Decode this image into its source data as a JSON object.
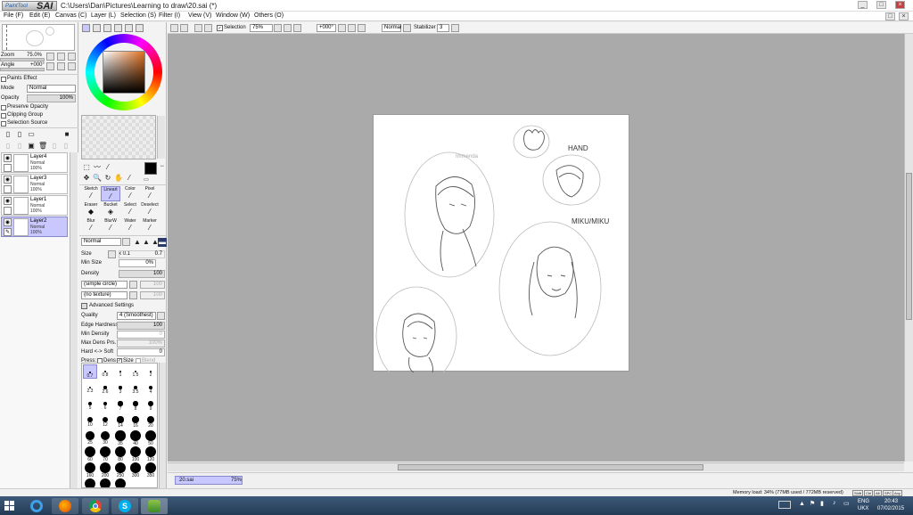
{
  "app": {
    "logo_sub": "PaintTool",
    "logo_main": "SAI",
    "title": "C:\\Users\\Dan\\Pictures\\Learning to draw\\20.sai (*)",
    "win_min": "_",
    "win_max": "□",
    "win_close": "×",
    "doc_min": "_",
    "doc_max": "□",
    "doc_close": "×"
  },
  "menu": [
    "File (F)",
    "Edit (E)",
    "Canvas (C)",
    "Layer (L)",
    "Selection (S)",
    "Filter (I)",
    "View (V)",
    "Window (W)",
    "Others (O)"
  ],
  "navigator": {
    "zoom_label": "Zoom",
    "zoom_value": "75.0%",
    "angle_label": "Angle",
    "angle_value": "+000°"
  },
  "layer_props": {
    "paints_effect": "Paints Effect",
    "mode_label": "Mode",
    "mode_value": "Normal",
    "opacity_label": "Opacity",
    "opacity_value": "100%",
    "preserve_opacity": "Preserve Opacity",
    "clipping_group": "Clipping Group",
    "selection_source": "Selection Source"
  },
  "layers": [
    {
      "name": "Layer4",
      "mode": "Normal",
      "opacity": "100%",
      "selected": false
    },
    {
      "name": "Layer3",
      "mode": "Normal",
      "opacity": "100%",
      "selected": false
    },
    {
      "name": "Layer1",
      "mode": "Normal",
      "opacity": "100%",
      "selected": false
    },
    {
      "name": "Layer2",
      "mode": "Normal",
      "opacity": "100%",
      "selected": true
    }
  ],
  "brush_tools": [
    {
      "label": "Sketch",
      "selected": false
    },
    {
      "label": "Lineart",
      "selected": true
    },
    {
      "label": "Color",
      "selected": false
    },
    {
      "label": "Pixel",
      "selected": false
    },
    {
      "label": "Eraser",
      "selected": false
    },
    {
      "label": "Bucket",
      "selected": false
    },
    {
      "label": "Select",
      "selected": false
    },
    {
      "label": "Deselect",
      "selected": false
    },
    {
      "label": "Blur",
      "selected": false
    },
    {
      "label": "BlurW",
      "selected": false
    },
    {
      "label": "Water",
      "selected": false
    },
    {
      "label": "Marker",
      "selected": false
    }
  ],
  "brush_settings": {
    "blend_mode": "Normal",
    "size_label": "Size",
    "size_mult": "x 0.1",
    "size_value": "0.7",
    "min_size_label": "Min Size",
    "min_size_value": "0%",
    "density_label": "Density",
    "density_value": "100",
    "shape": "(simple circle)",
    "shape_value": "100",
    "texture": "(no texture)",
    "texture_value": "100",
    "advanced": "Advanced Settings",
    "quality_label": "Quality",
    "quality_value": "4 (Smoothest)",
    "edge_hardness_label": "Edge Hardness",
    "edge_hardness_value": "100",
    "min_density_label": "Min Density",
    "min_density_value": "0",
    "max_dens_prs_label": "Max Dens Prs.",
    "max_dens_prs_value": "100%",
    "hard_soft_label": "Hard <-> Soft",
    "hard_soft_value": "0",
    "press_label": "Press:",
    "press_dens": "Dens",
    "press_size": "Size",
    "press_blend": "Blend"
  },
  "brush_sizes": [
    "0.7",
    "0.8",
    "1",
    "1.5",
    "2",
    "2.3",
    "2.6",
    "3",
    "3.5",
    "4",
    "5",
    "6",
    "7",
    "8",
    "9",
    "10",
    "12",
    "14",
    "16",
    "20",
    "25",
    "30",
    "35",
    "40",
    "50",
    "60",
    "70",
    "80",
    "100",
    "120",
    "160",
    "200",
    "250",
    "300",
    "350",
    "400",
    "450",
    "500"
  ],
  "toolbar": {
    "selection_label": "Selection",
    "zoom_value": "75%",
    "angle_value": "+000°",
    "mode_value": "Normal",
    "stabilizer_label": "Stabilizer",
    "stabilizer_value": "3"
  },
  "canvas_annotations": {
    "hand": "HAND",
    "mikumiku": "MIKU/MIKU",
    "face_label": "Immenda"
  },
  "document_tab": {
    "name": "20.sai",
    "zoom": "75%"
  },
  "status": {
    "memory": "Memory load: 34% (77MB used / 772MB reserved)",
    "keys": [
      "Shift",
      "Ctrl",
      "Alt",
      "SPC",
      "Any"
    ]
  },
  "taskbar": {
    "lang": "ENG",
    "region": "UKX",
    "time": "20:43",
    "date": "07/02/2015",
    "icons": [
      "start-icon",
      "ie-icon",
      "firefox-icon",
      "chrome-icon",
      "skype-icon",
      "sai-icon"
    ]
  },
  "colors": {
    "selected_layer": "#c8c8ff",
    "workspace": "#aaaaaa",
    "taskbar": "#2f4866",
    "foreground": "#000000",
    "background": "#ffffff"
  }
}
